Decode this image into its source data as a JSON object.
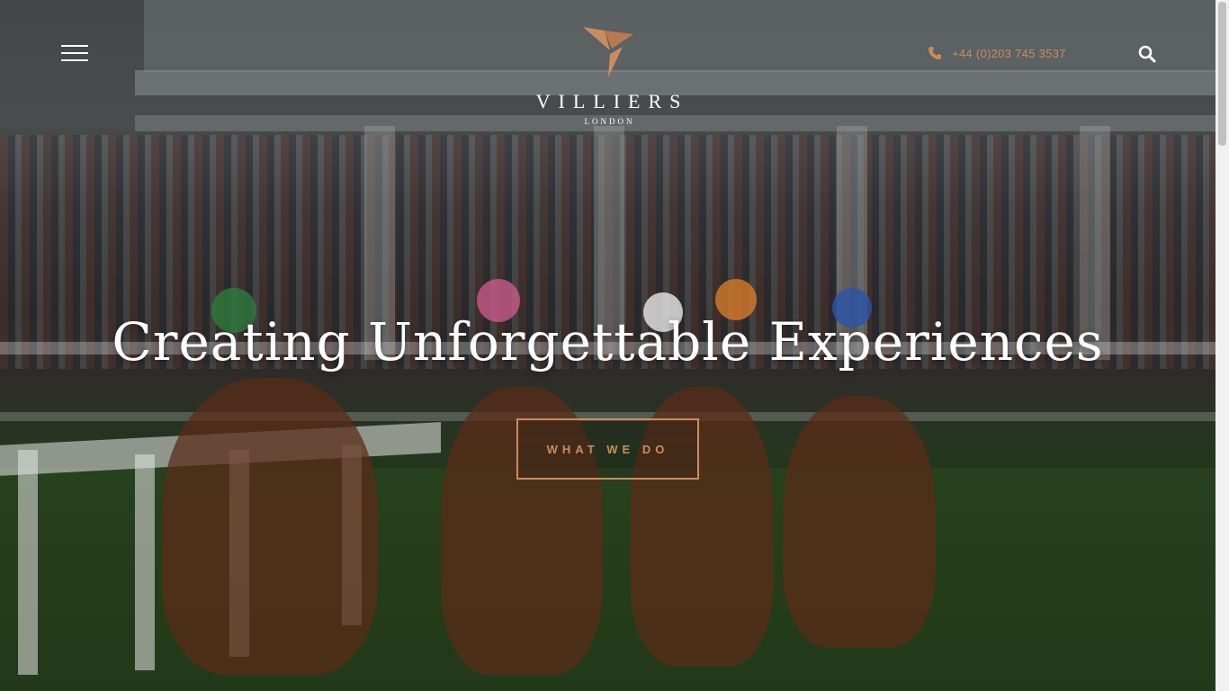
{
  "header": {
    "menu_icon": "hamburger-icon",
    "brand_name": "VILLIERS",
    "brand_location": "LONDON",
    "phone_icon": "phone-icon",
    "phone_number": "+44 (0)203 745 3537",
    "search_icon": "search-icon"
  },
  "hero": {
    "headline": "Creating Unforgettable Experiences",
    "cta_label": "WHAT WE DO"
  },
  "colors": {
    "accent": "#c98c62",
    "text": "#ffffff"
  }
}
